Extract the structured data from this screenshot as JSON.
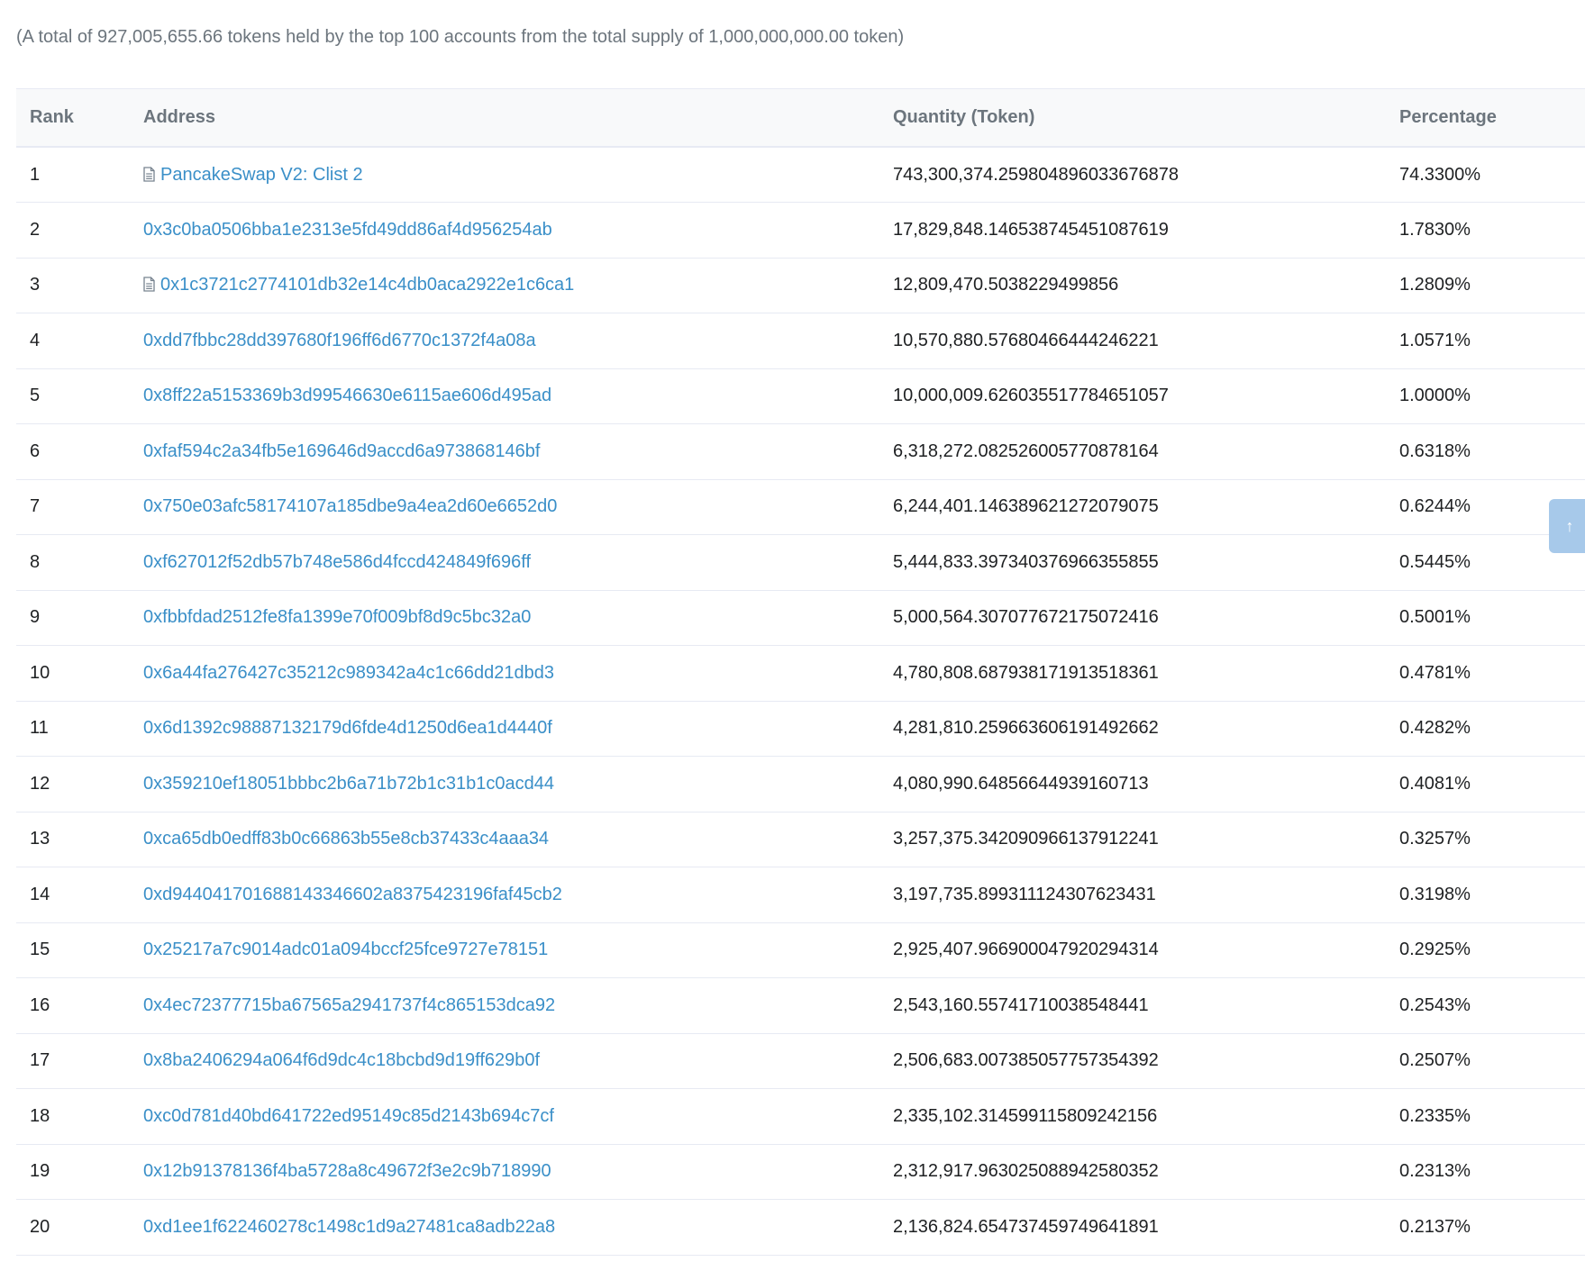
{
  "summary": "(A total of 927,005,655.66 tokens held by the top 100 accounts from the total supply of 1,000,000,000.00 token)",
  "table": {
    "headers": {
      "rank": "Rank",
      "address": "Address",
      "quantity": "Quantity (Token)",
      "percentage": "Percentage"
    },
    "rows": [
      {
        "rank": "1",
        "address": "PancakeSwap V2: Clist 2",
        "contract": true,
        "quantity": "743,300,374.259804896033676878",
        "percentage": "74.3300%"
      },
      {
        "rank": "2",
        "address": "0x3c0ba0506bba1e2313e5fd49dd86af4d956254ab",
        "contract": false,
        "quantity": "17,829,848.146538745451087619",
        "percentage": "1.7830%"
      },
      {
        "rank": "3",
        "address": "0x1c3721c2774101db32e14c4db0aca2922e1c6ca1",
        "contract": true,
        "quantity": "12,809,470.5038229499856",
        "percentage": "1.2809%"
      },
      {
        "rank": "4",
        "address": "0xdd7fbbc28dd397680f196ff6d6770c1372f4a08a",
        "contract": false,
        "quantity": "10,570,880.57680466444246221",
        "percentage": "1.0571%"
      },
      {
        "rank": "5",
        "address": "0x8ff22a5153369b3d99546630e6115ae606d495ad",
        "contract": false,
        "quantity": "10,000,009.626035517784651057",
        "percentage": "1.0000%"
      },
      {
        "rank": "6",
        "address": "0xfaf594c2a34fb5e169646d9accd6a973868146bf",
        "contract": false,
        "quantity": "6,318,272.082526005770878164",
        "percentage": "0.6318%"
      },
      {
        "rank": "7",
        "address": "0x750e03afc58174107a185dbe9a4ea2d60e6652d0",
        "contract": false,
        "quantity": "6,244,401.146389621272079075",
        "percentage": "0.6244%"
      },
      {
        "rank": "8",
        "address": "0xf627012f52db57b748e586d4fccd424849f696ff",
        "contract": false,
        "quantity": "5,444,833.397340376966355855",
        "percentage": "0.5445%"
      },
      {
        "rank": "9",
        "address": "0xfbbfdad2512fe8fa1399e70f009bf8d9c5bc32a0",
        "contract": false,
        "quantity": "5,000,564.307077672175072416",
        "percentage": "0.5001%"
      },
      {
        "rank": "10",
        "address": "0x6a44fa276427c35212c989342a4c1c66dd21dbd3",
        "contract": false,
        "quantity": "4,780,808.687938171913518361",
        "percentage": "0.4781%"
      },
      {
        "rank": "11",
        "address": "0x6d1392c98887132179d6fde4d1250d6ea1d4440f",
        "contract": false,
        "quantity": "4,281,810.259663606191492662",
        "percentage": "0.4282%"
      },
      {
        "rank": "12",
        "address": "0x359210ef18051bbbc2b6a71b72b1c31b1c0acd44",
        "contract": false,
        "quantity": "4,080,990.64856644939160713",
        "percentage": "0.4081%"
      },
      {
        "rank": "13",
        "address": "0xca65db0edff83b0c66863b55e8cb37433c4aaa34",
        "contract": false,
        "quantity": "3,257,375.342090966137912241",
        "percentage": "0.3257%"
      },
      {
        "rank": "14",
        "address": "0xd944041701688143346602a8375423196faf45cb2",
        "contract": false,
        "quantity": "3,197,735.899311124307623431",
        "percentage": "0.3198%"
      },
      {
        "rank": "15",
        "address": "0x25217a7c9014adc01a094bccf25fce9727e78151",
        "contract": false,
        "quantity": "2,925,407.966900047920294314",
        "percentage": "0.2925%"
      },
      {
        "rank": "16",
        "address": "0x4ec72377715ba67565a2941737f4c865153dca92",
        "contract": false,
        "quantity": "2,543,160.55741710038548441",
        "percentage": "0.2543%"
      },
      {
        "rank": "17",
        "address": "0x8ba2406294a064f6d9dc4c18bcbd9d19ff629b0f",
        "contract": false,
        "quantity": "2,506,683.007385057757354392",
        "percentage": "0.2507%"
      },
      {
        "rank": "18",
        "address": "0xc0d781d40bd641722ed95149c85d2143b694c7cf",
        "contract": false,
        "quantity": "2,335,102.314599115809242156",
        "percentage": "0.2335%"
      },
      {
        "rank": "19",
        "address": "0x12b91378136f4ba5728a8c49672f3e2c9b718990",
        "contract": false,
        "quantity": "2,312,917.963025088942580352",
        "percentage": "0.2313%"
      },
      {
        "rank": "20",
        "address": "0xd1ee1f622460278c1498c1d9a27481ca8adb22a8",
        "contract": false,
        "quantity": "2,136,824.654737459749641891",
        "percentage": "0.2137%"
      }
    ]
  },
  "icons": {
    "contract": "file-text-icon",
    "scroll_top": "arrow-up-icon"
  },
  "colors": {
    "link": "#3a8fc8",
    "header_bg": "#f8f9fa",
    "border": "#e7eaf3",
    "muted_text": "#6c757d",
    "scroll_button": "#a7c9ea"
  }
}
